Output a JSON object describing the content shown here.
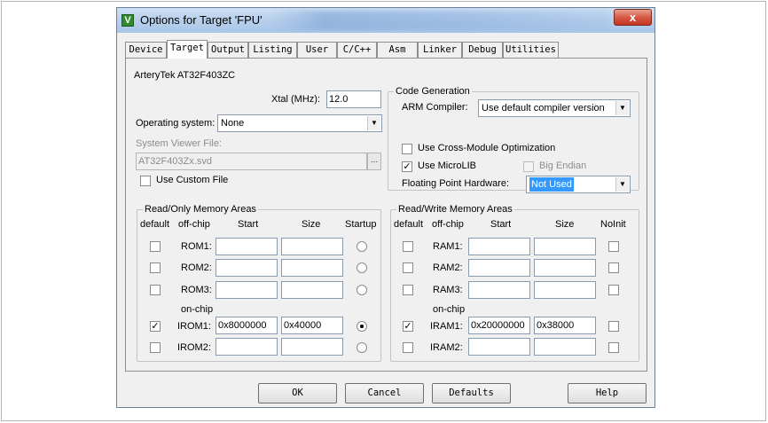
{
  "window": {
    "title": "Options for Target 'FPU'",
    "close_glyph": "x"
  },
  "tabs": [
    "Device",
    "Target",
    "Output",
    "Listing",
    "User",
    "C/C++",
    "Asm",
    "Linker",
    "Debug",
    "Utilities"
  ],
  "active_tab": "Target",
  "device_name": "ArteryTek AT32F403ZC",
  "xtal": {
    "label": "Xtal (MHz):",
    "value": "12.0"
  },
  "os": {
    "label": "Operating system:",
    "value": "None"
  },
  "svd": {
    "label": "System Viewer File:",
    "value": "AT32F403Zx.svd",
    "browse": "..."
  },
  "use_custom_file": {
    "label": "Use Custom File",
    "checked": false
  },
  "code_generation": {
    "title": "Code Generation",
    "compiler_label": "ARM Compiler:",
    "compiler_value": "Use default compiler version",
    "cross_module": {
      "label": "Use Cross-Module Optimization",
      "checked": false
    },
    "microlib": {
      "label": "Use MicroLIB",
      "checked": true
    },
    "big_endian": {
      "label": "Big Endian",
      "checked": false
    },
    "fpu_label": "Floating Point Hardware:",
    "fpu_value": "Not Used"
  },
  "ro_memory": {
    "title": "Read/Only Memory Areas",
    "headers": {
      "default": "default",
      "offchip": "off-chip",
      "start": "Start",
      "size": "Size",
      "extra": "Startup"
    },
    "onchip_label": "on-chip",
    "rows": [
      {
        "name": "ROM1:",
        "default": false,
        "start": "",
        "size": "",
        "startup": false
      },
      {
        "name": "ROM2:",
        "default": false,
        "start": "",
        "size": "",
        "startup": false
      },
      {
        "name": "ROM3:",
        "default": false,
        "start": "",
        "size": "",
        "startup": false
      },
      {
        "name": "IROM1:",
        "default": true,
        "start": "0x8000000",
        "size": "0x40000",
        "startup": true
      },
      {
        "name": "IROM2:",
        "default": false,
        "start": "",
        "size": "",
        "startup": false
      }
    ]
  },
  "rw_memory": {
    "title": "Read/Write Memory Areas",
    "headers": {
      "default": "default",
      "offchip": "off-chip",
      "start": "Start",
      "size": "Size",
      "extra": "NoInit"
    },
    "onchip_label": "on-chip",
    "rows": [
      {
        "name": "RAM1:",
        "default": false,
        "start": "",
        "size": "",
        "noinit": false
      },
      {
        "name": "RAM2:",
        "default": false,
        "start": "",
        "size": "",
        "noinit": false
      },
      {
        "name": "RAM3:",
        "default": false,
        "start": "",
        "size": "",
        "noinit": false
      },
      {
        "name": "IRAM1:",
        "default": true,
        "start": "0x20000000",
        "size": "0x38000",
        "noinit": false
      },
      {
        "name": "IRAM2:",
        "default": false,
        "start": "",
        "size": "",
        "noinit": false
      }
    ]
  },
  "buttons": {
    "ok": "OK",
    "cancel": "Cancel",
    "defaults": "Defaults",
    "help": "Help"
  },
  "check_glyph": "✓",
  "arrow_glyph": "▼"
}
